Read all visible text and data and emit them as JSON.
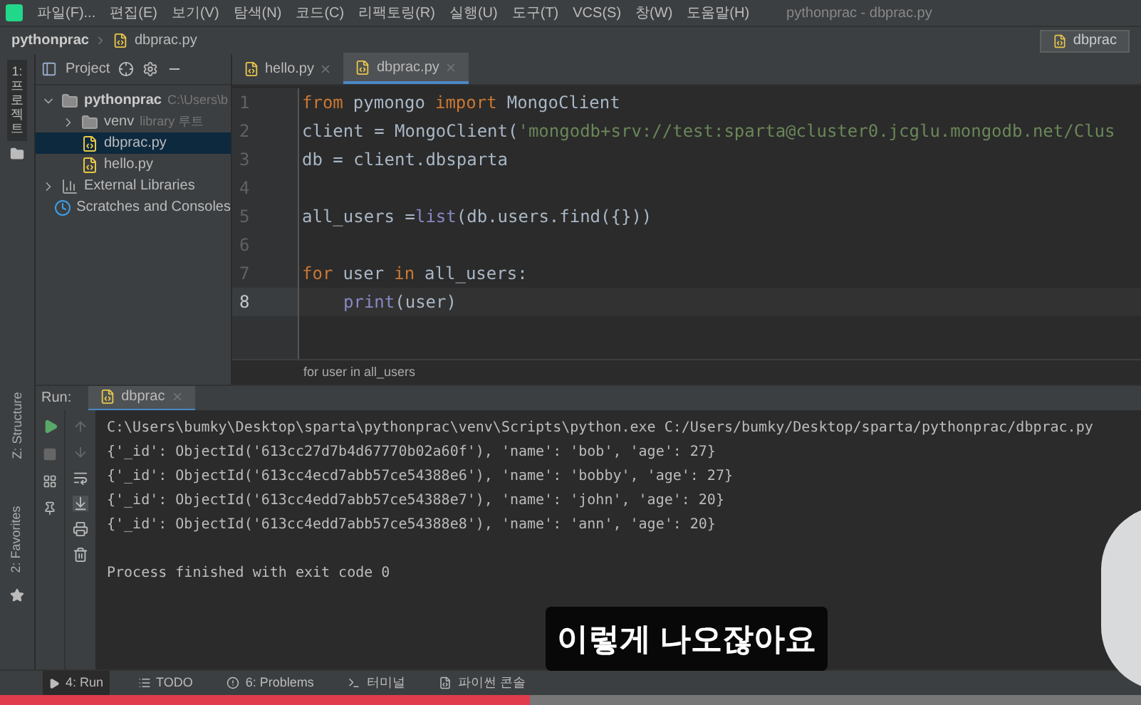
{
  "menu_bar": {
    "items": [
      "파일(F)...",
      "편집(E)",
      "보기(V)",
      "탐색(N)",
      "코드(C)",
      "리팩토링(R)",
      "실행(U)",
      "도구(T)",
      "VCS(S)",
      "창(W)",
      "도움말(H)"
    ],
    "title": "pythonprac - dbprac.py"
  },
  "breadcrumb": {
    "items": [
      "pythonprac",
      "dbprac.py"
    ],
    "run_config": "dbprac"
  },
  "left_strip": {
    "top": "1: 프로젝트",
    "middle": "Z: Structure",
    "bottom": "2: Favorites"
  },
  "project_panel": {
    "title": "Project",
    "tree": [
      {
        "label": "pythonprac",
        "note": "C:\\Users\\b",
        "kind": "folder",
        "expanded": true,
        "selected": false,
        "children": [
          {
            "label": "venv",
            "note": "library 루트",
            "kind": "folder",
            "expanded": false,
            "selected": false
          },
          {
            "label": "dbprac.py",
            "kind": "file",
            "selected": true
          },
          {
            "label": "hello.py",
            "kind": "file",
            "selected": false
          }
        ]
      },
      {
        "label": "External Libraries",
        "kind": "library",
        "expanded": false,
        "selected": false
      },
      {
        "label": "Scratches and Consoles",
        "kind": "scratch",
        "selected": false
      }
    ]
  },
  "editor_tabs": [
    {
      "label": "hello.py",
      "selected": false
    },
    {
      "label": "dbprac.py",
      "selected": true
    }
  ],
  "editor": {
    "lines": [
      {
        "number": "1",
        "current": false,
        "tokens": [
          {
            "text": "from",
            "kind": "keyword"
          },
          {
            "text": "pymongo",
            "kind": "name"
          },
          {
            "text": "import",
            "kind": "keyword"
          },
          {
            "text": "MongoClient",
            "kind": "name"
          }
        ]
      },
      {
        "number": "2",
        "current": false,
        "tokens": [
          {
            "text": "client = MongoClient(",
            "kind": "name"
          },
          {
            "text": "'mongodb+srv://test:sparta@cluster0.jcglu.mongodb.net/Clus",
            "kind": "string"
          }
        ]
      },
      {
        "number": "3",
        "current": false,
        "tokens": [
          {
            "text": "db = client.dbsparta",
            "kind": "name"
          }
        ]
      },
      {
        "number": "4",
        "current": false
      },
      {
        "number": "5",
        "current": false,
        "tokens": [
          {
            "text": "all_users = ",
            "kind": "name"
          },
          {
            "text": "list",
            "kind": "builtin"
          },
          {
            "text": "(db.users.find({}))",
            "kind": "name"
          }
        ]
      },
      {
        "number": "6",
        "current": false
      },
      {
        "number": "7",
        "current": false,
        "tokens": [
          {
            "text": "for",
            "kind": "keyword"
          },
          {
            "text": "user",
            "kind": "name"
          },
          {
            "text": "in",
            "kind": "keyword"
          },
          {
            "text": "all_users:",
            "kind": "name"
          }
        ],
        "children": [
          {
            "number": "8",
            "current": true,
            "tokens": [
              {
                "text": "print",
                "kind": "builtin"
              },
              {
                "text": "(user)",
                "kind": "name"
              }
            ]
          }
        ]
      }
    ],
    "footer": "for user in all_users"
  },
  "run_panel": {
    "label": "Run:",
    "tab": "dbprac",
    "output": [
      "C:\\Users\\bumky\\Desktop\\sparta\\pythonprac\\venv\\Scripts\\python.exe C:/Users/bumky/Desktop/sparta/pythonprac/dbprac.py",
      "{'_id': ObjectId('613cc27d7b4d67770b02a60f'), 'name': 'bob', 'age': 27}",
      "{'_id': ObjectId('613cc4ecd7abb57ce54388e6'), 'name': 'bobby', 'age': 27}",
      "{'_id': ObjectId('613cc4edd7abb57ce54388e7'), 'name': 'john', 'age': 20}",
      "{'_id': ObjectId('613cc4edd7abb57ce54388e8'), 'name': 'ann', 'age': 20}"
    ],
    "status": "Process finished with exit code 0"
  },
  "bottom_tabs": [
    {
      "label": "4: Run",
      "selected": true
    },
    {
      "label": "TODO",
      "selected": false
    },
    {
      "label": "6: Problems",
      "selected": false
    },
    {
      "label": "터미널",
      "selected": false
    },
    {
      "label": "파이썬 콘솔",
      "selected": false
    }
  ],
  "subtitle": "이렇게 나오잖아요",
  "video_progress": {
    "level": 0.465
  }
}
